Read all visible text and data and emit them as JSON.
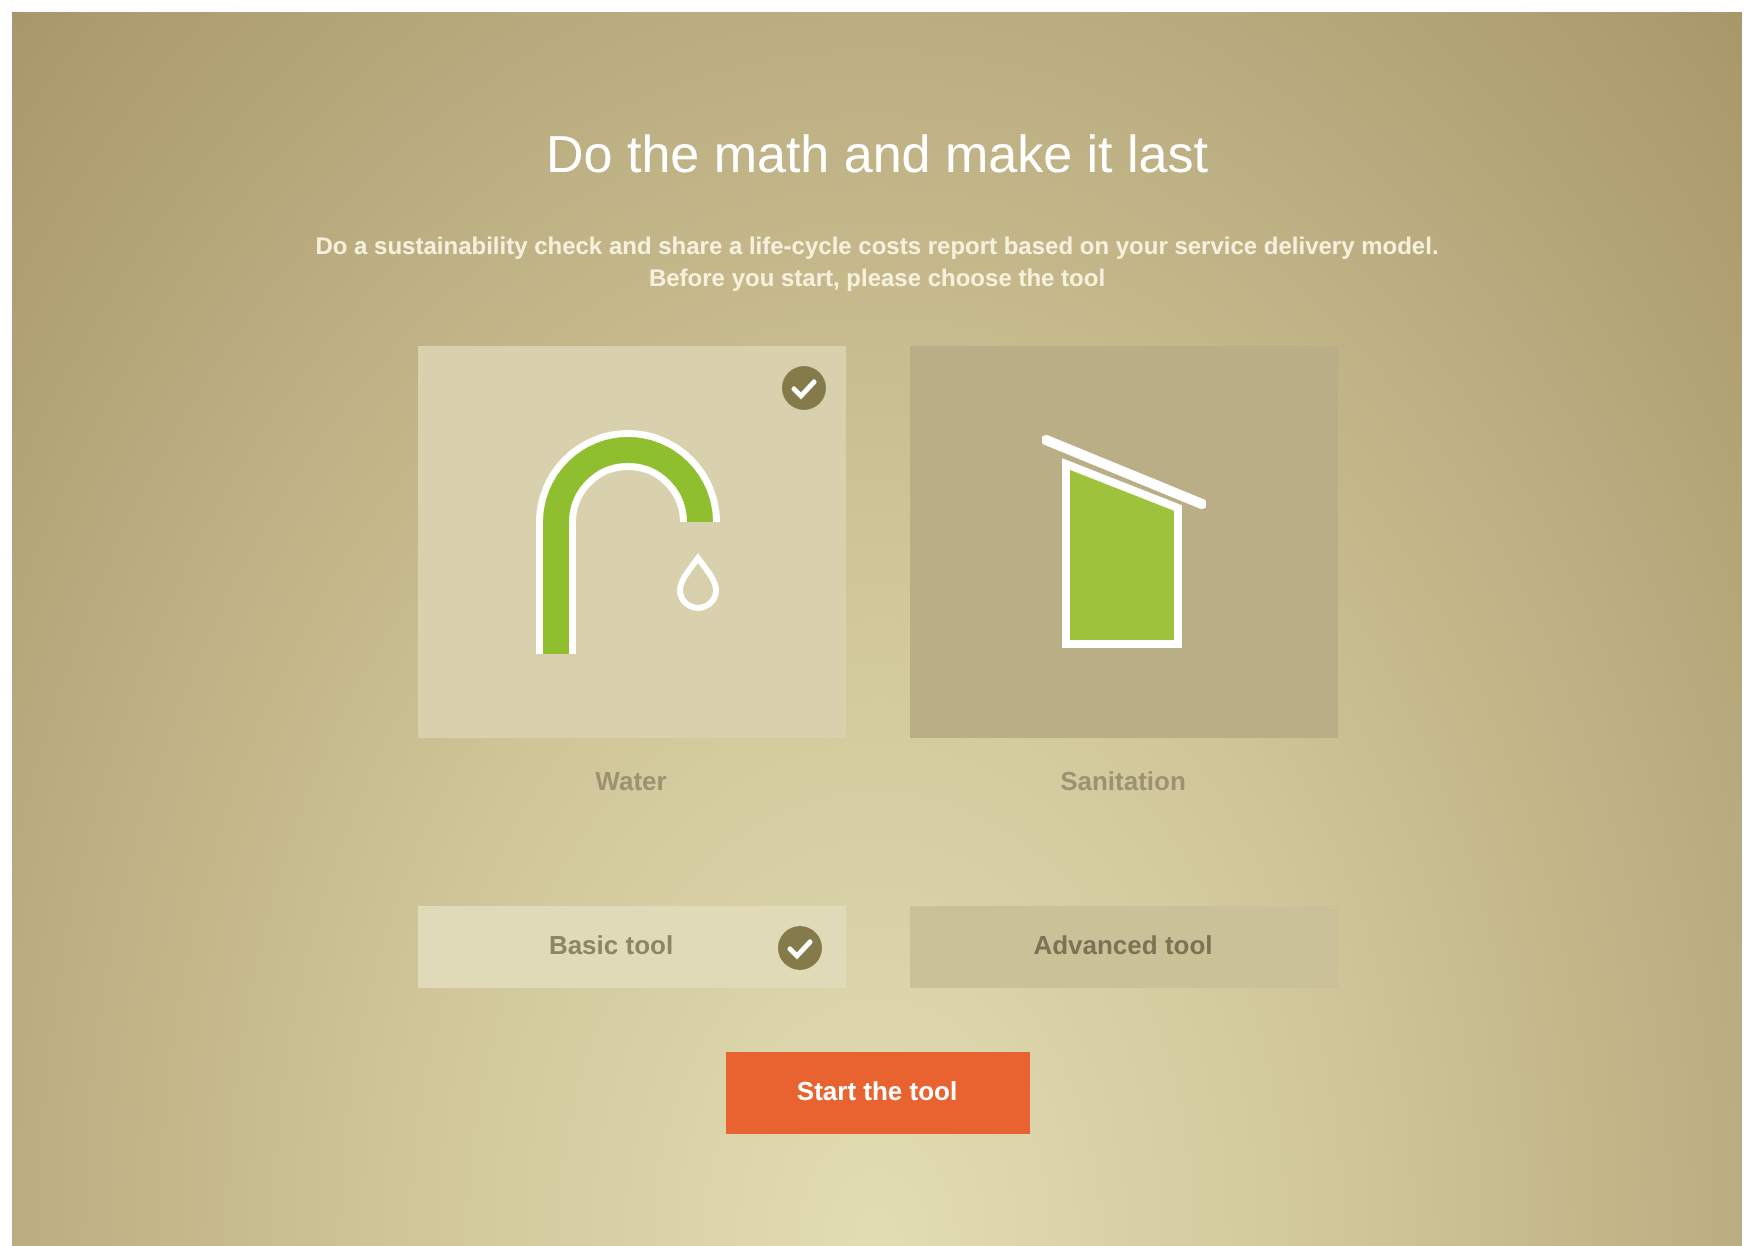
{
  "title": "Do the math and make it last",
  "subtitle": [
    "Do a sustainability check and share a life-cycle costs report based on your service delivery model.",
    "Before you start, please choose the tool"
  ],
  "sectors": [
    {
      "kind": "tap",
      "label": "Water",
      "selected": true
    },
    {
      "kind": "latrine",
      "label": "Sanitation",
      "selected": false
    }
  ],
  "tools": [
    {
      "label": "Basic tool",
      "selected": true
    },
    {
      "label": "Advanced tool",
      "selected": false
    }
  ],
  "start_button": "Start the tool"
}
